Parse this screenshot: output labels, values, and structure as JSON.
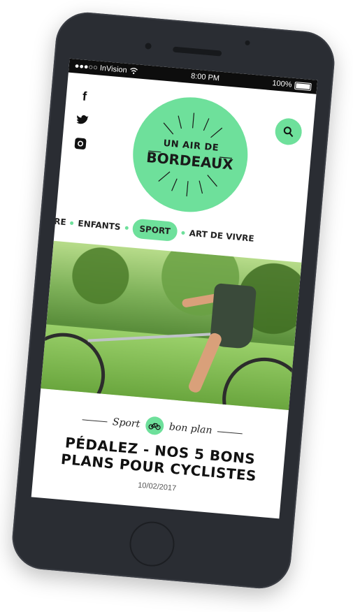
{
  "status_bar": {
    "carrier": "●●●○○ InVision",
    "time": "8:00 PM",
    "battery": "100%"
  },
  "header": {
    "social": [
      {
        "icon": "facebook-icon",
        "glyph": "f"
      },
      {
        "icon": "twitter-icon",
        "glyph": "🐦"
      },
      {
        "icon": "instagram-icon",
        "glyph": "◘"
      }
    ],
    "logo": {
      "line1": "UN AIR DE",
      "line2": "BORDEAUX"
    },
    "search_icon": "search-icon"
  },
  "nav": {
    "items": [
      "RE",
      "ENFANTS",
      "SPORT",
      "ART DE VIVRE"
    ],
    "active": "SPORT"
  },
  "article": {
    "tag_left": "Sport",
    "tag_right": "bon plan",
    "title": "PÉDALEZ - NOS 5 BONS PLANS POUR CYCLISTES",
    "date": "10/02/2017"
  },
  "colors": {
    "accent": "#6ee09b",
    "phone": "#2a2d33"
  }
}
